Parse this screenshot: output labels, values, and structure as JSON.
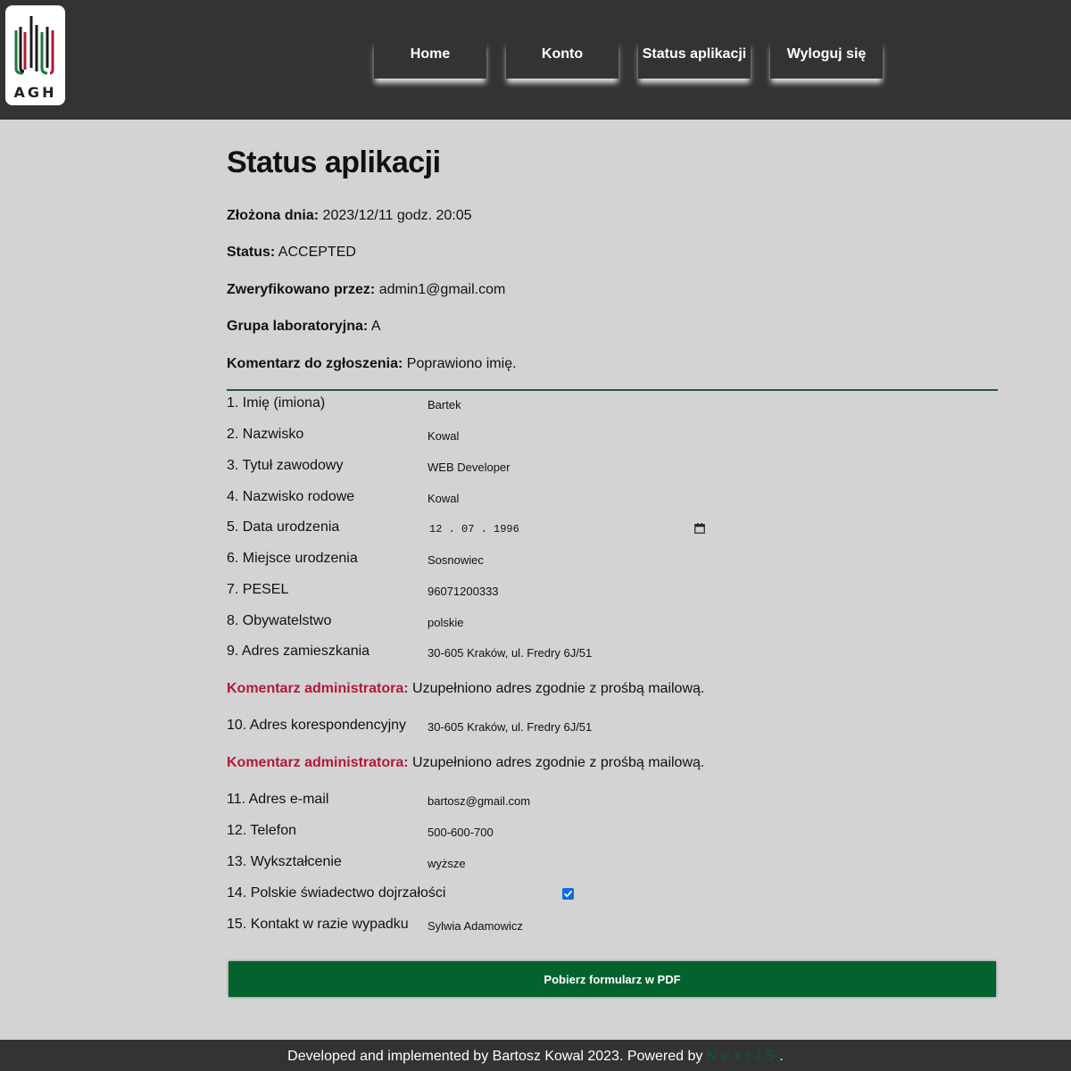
{
  "brand": {
    "logo_text": "AGH",
    "colors": {
      "header_bg": "#333333",
      "page_bg": "#d3d3d3",
      "accent_green": "#04622f",
      "admin_red": "#b0193a",
      "checkbox_blue": "#0b6ee0"
    }
  },
  "nav": {
    "home": "Home",
    "account": "Konto",
    "status": "Status aplikacji",
    "logout": "Wyloguj się"
  },
  "page": {
    "title": "Status aplikacji",
    "submitted_label": "Złożona dnia:",
    "submitted_value": " 2023/12/11 godz. 20:05",
    "status_label": "Status:",
    "status_value": " ACCEPTED",
    "verified_label": "Zweryfikowano przez:",
    "verified_value": " admin1@gmail.com",
    "group_label": "Grupa laboratoryjna:",
    "group_value": " A",
    "comment_label": "Komentarz do zgłoszenia:",
    "comment_value": " Poprawiono imię."
  },
  "form": {
    "rows": [
      {
        "label": "1. Imię (imiona)",
        "value": "Bartek"
      },
      {
        "label": "2. Nazwisko",
        "value": "Kowal"
      },
      {
        "label": "3. Tytuł zawodowy",
        "value": "WEB Developer"
      },
      {
        "label": "4. Nazwisko rodowe",
        "value": "Kowal"
      },
      {
        "label": "5. Data urodzenia",
        "value": "12 . 07 . 1996"
      },
      {
        "label": "6. Miejsce urodzenia",
        "value": "Sosnowiec"
      },
      {
        "label": "7. PESEL",
        "value": "96071200333"
      },
      {
        "label": "8. Obywatelstwo",
        "value": "polskie"
      },
      {
        "label": "9. Adres zamieszkania",
        "value": "30-605 Kraków, ul. Fredry 6J/51"
      },
      {
        "label": "10. Adres korespondencyjny",
        "value": "30-605 Kraków, ul. Fredry 6J/51"
      },
      {
        "label": "11. Adres e-mail",
        "value": "bartosz@gmail.com"
      },
      {
        "label": "12. Telefon",
        "value": "500-600-700"
      },
      {
        "label": "13. Wykształcenie",
        "value": "wyższe"
      },
      {
        "label": "14. Polskie świadectwo dojrzałości",
        "checked": true
      },
      {
        "label": "15. Kontakt w razie wypadku",
        "value": "Sylwia Adamowicz"
      }
    ],
    "admin_comments": [
      {
        "label": "Komentarz administratora:",
        "text": " Uzupełniono adres zgodnie z prośbą mailową."
      },
      {
        "label": "Komentarz administratora:",
        "text": " Uzupełniono adres zgodnie z prośbą mailową."
      }
    ],
    "icons": {
      "date": "calendar-icon",
      "checkbox": "checkmark-icon"
    },
    "pdf_button": "Pobierz formularz w PDF"
  },
  "footer": {
    "text": "Developed and implemented by Bartosz Kowal 2023. Powered by ",
    "nextjs": "NextJS",
    "end": "."
  }
}
